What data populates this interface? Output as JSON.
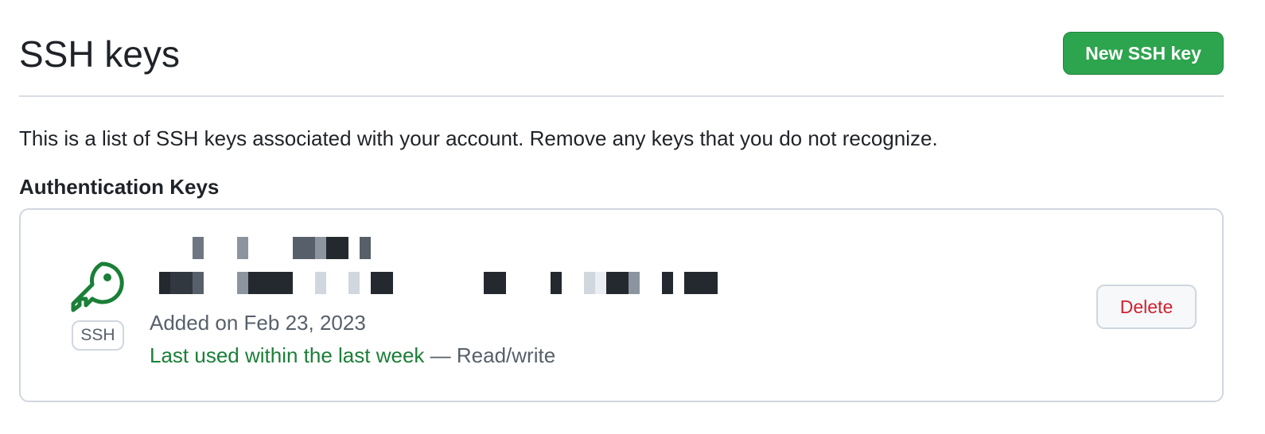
{
  "header": {
    "title": "SSH keys",
    "new_key_label": "New SSH key"
  },
  "description": "This is a list of SSH keys associated with your account. Remove any keys that you do not recognize.",
  "section": {
    "heading": "Authentication Keys"
  },
  "key": {
    "type_badge": "SSH",
    "added_on": "Added on Feb 23, 2023",
    "last_used": "Last used within the last week",
    "separator": " — ",
    "access": "Read/write",
    "delete_label": "Delete"
  },
  "colors": {
    "primary_green": "#2da44e",
    "success_text": "#1a7f37",
    "danger_text": "#cf222e",
    "muted_text": "#57606a",
    "border": "#d0d7de"
  },
  "icons": {
    "key": "key-icon"
  }
}
